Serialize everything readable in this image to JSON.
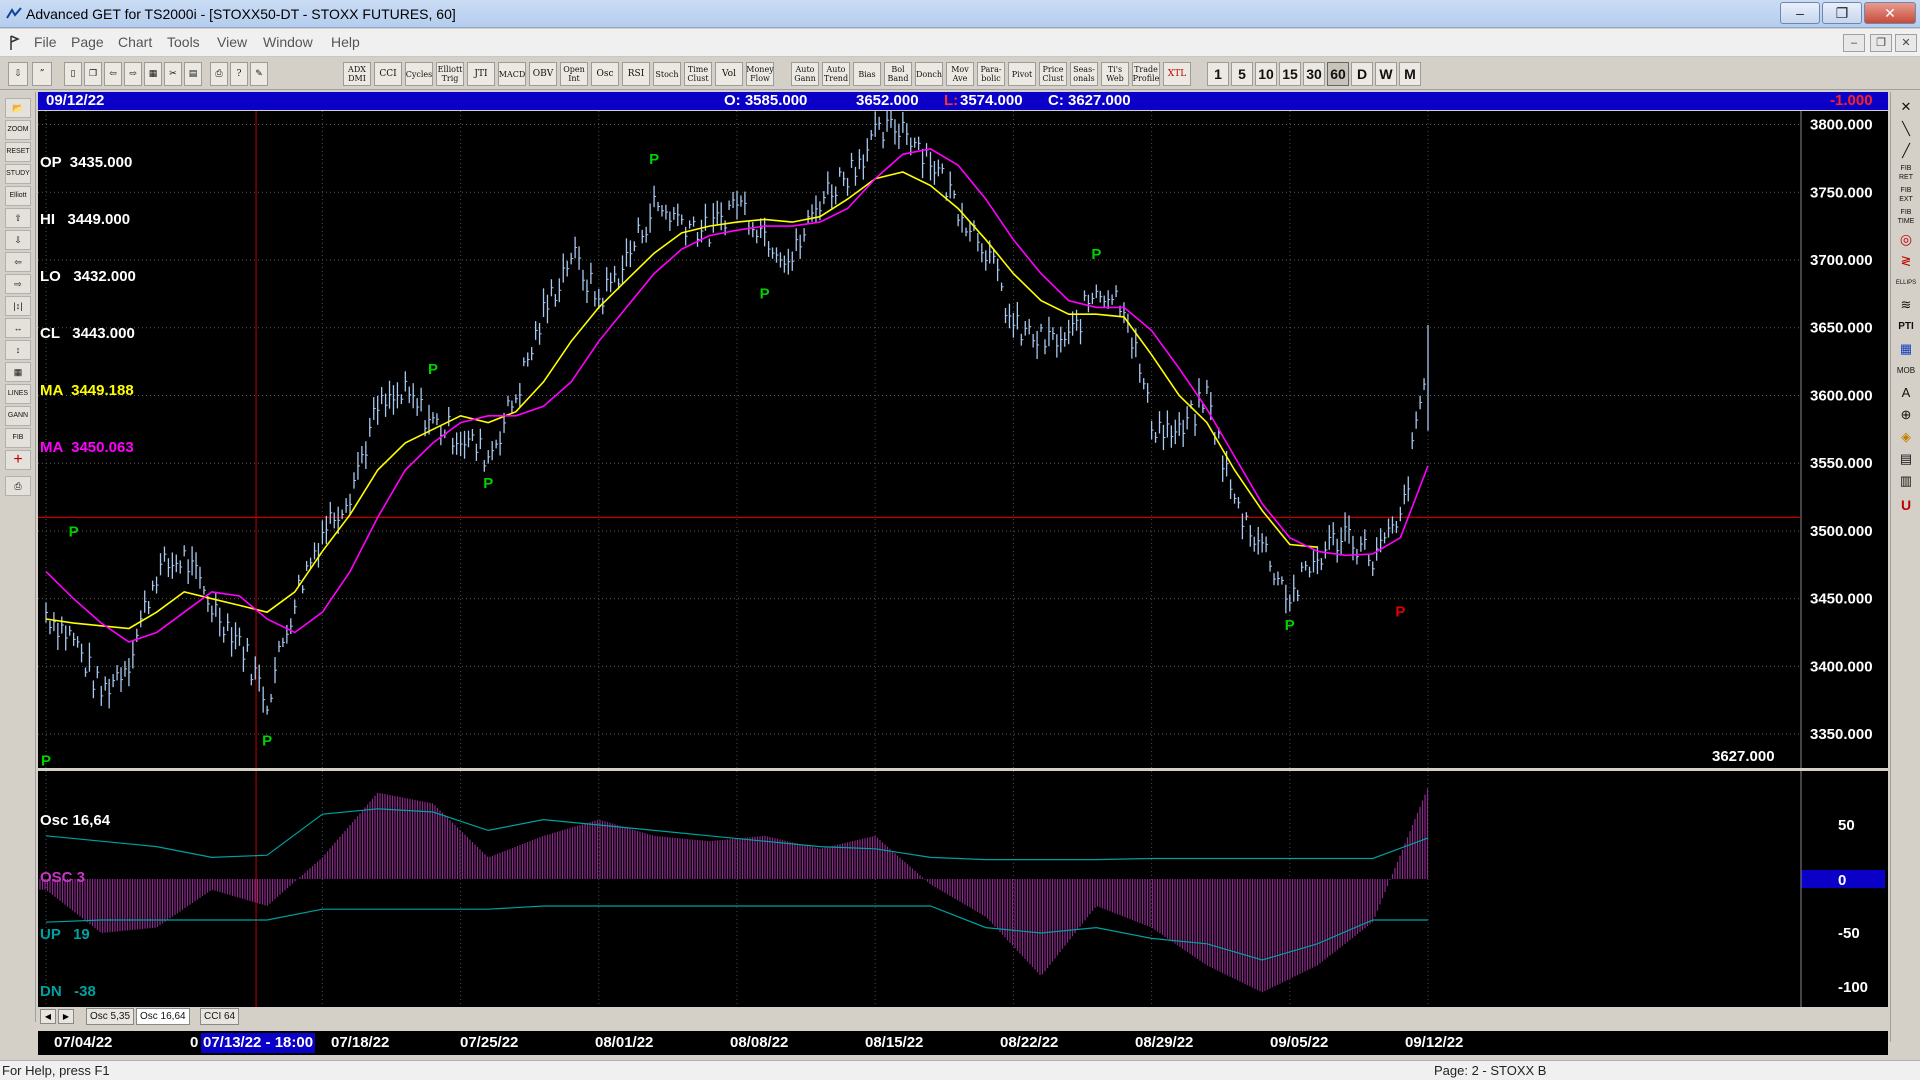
{
  "window": {
    "title": "Advanced GET for TS2000i - [STOXX50-DT - STOXX FUTURES, 60]",
    "buttons": [
      "–",
      "❐",
      "✕"
    ]
  },
  "menu": [
    "File",
    "Page",
    "Chart",
    "Tools",
    "View",
    "Window",
    "Help"
  ],
  "mdi_controls": [
    "–",
    "❐",
    "✕"
  ],
  "toolbar": {
    "indicators": [
      "ADX DMI",
      "CCI",
      "Cycles",
      "Elliott Trig",
      "JTI",
      "MACD",
      "OBV",
      "Open Int",
      "Osc",
      "RSI",
      "Stoch",
      "Time Clust",
      "Vol",
      "Money Flow",
      "Auto Gann",
      "Auto Trend",
      "Bias",
      "Bol Band",
      "Donch",
      "Mov Ave",
      "Para-bolic",
      "Pivot",
      "Price Clust",
      "Seas-onals",
      "Ti's Web",
      "Trade Profile",
      "XTL"
    ],
    "periods": [
      "1",
      "5",
      "10",
      "15",
      "30",
      "60",
      "D",
      "W",
      "M"
    ],
    "active_period": "60"
  },
  "left_tools": [
    "📂",
    "ZOOM",
    "RESET",
    "STUDY",
    "Elliott",
    "⇧",
    "⇩",
    "⇦",
    "⇨",
    "|↕|",
    "↔",
    "↕",
    "▦",
    "LINES",
    "GANN",
    "FIB",
    "+",
    "⎙"
  ],
  "right_tools": [
    "✕",
    "╲",
    "╱",
    "FIB RET",
    "FIB EXT",
    "FIB TIME",
    "◎",
    "≷",
    "ELLIPS",
    "≋",
    "PTI",
    "▦",
    "MOB",
    "A",
    "⊕",
    "◈",
    "▤",
    "▥",
    "U"
  ],
  "infobar": {
    "date": "09/12/22",
    "open": "O: 3585.000",
    "high": "3652.000",
    "low_label": "L:",
    "low": " 3574.000",
    "close": "C: 3627.000",
    "change": "-1.000"
  },
  "price_legend": [
    {
      "label": "OP  3435.000",
      "color": "#ffffff"
    },
    {
      "label": "HI   3449.000",
      "color": "#ffffff"
    },
    {
      "label": "LO   3432.000",
      "color": "#ffffff"
    },
    {
      "label": "CL   3443.000",
      "color": "#ffffff"
    },
    {
      "label": "MA  3449.188",
      "color": "#ffff00"
    },
    {
      "label": "MA  3450.063",
      "color": "#ff00ff"
    }
  ],
  "last_price_label": "3627.000",
  "osc_legend": [
    {
      "label": "Osc 16,64",
      "color": "#ffffff"
    },
    {
      "label": "OSC 3",
      "color": "#cc33cc"
    },
    {
      "label": "UP   19",
      "color": "#00a0a0"
    },
    {
      "label": "DN   -38",
      "color": "#00a0a0"
    }
  ],
  "osc_zero_label": "0",
  "tabs": [
    "Osc 5,35",
    "Osc 16,64",
    "CCI 64"
  ],
  "active_tab": "Osc 16,64",
  "date_labels": [
    "07/04/22",
    "0",
    "07/18/22",
    "07/25/22",
    "08/01/22",
    "08/08/22",
    "08/15/22",
    "08/22/22",
    "08/29/22",
    "09/05/22",
    "09/12/22"
  ],
  "cursor_label": "07/13/22 - 18:00",
  "status": {
    "left": "For Help, press F1",
    "right": "Page: 2 - STOXX B"
  },
  "colors": {
    "bars": "#a8c8f0",
    "ma_fast": "#ffff00",
    "ma_slow": "#ff00ff",
    "pivot_high": "#00d000",
    "pivot_red": "#e00000",
    "osc_hist": "#8a2a8a",
    "bands": "#00a0a0",
    "crosshair": "#c00000",
    "infobar": "#0a00c8"
  },
  "chart_data": [
    {
      "type": "line",
      "title": "STOXX50-DT - STOXX FUTURES, 60",
      "x": [
        "07/04",
        "07/05",
        "07/06",
        "07/07",
        "07/08",
        "07/11",
        "07/12",
        "07/13",
        "07/14",
        "07/15",
        "07/18",
        "07/19",
        "07/20",
        "07/21",
        "07/22",
        "07/25",
        "07/26",
        "07/27",
        "07/28",
        "07/29",
        "08/01",
        "08/02",
        "08/03",
        "08/04",
        "08/05",
        "08/08",
        "08/09",
        "08/10",
        "08/11",
        "08/12",
        "08/15",
        "08/16",
        "08/17",
        "08/18",
        "08/19",
        "08/22",
        "08/23",
        "08/24",
        "08/25",
        "08/26",
        "08/29",
        "08/30",
        "08/31",
        "09/01",
        "09/02",
        "09/05",
        "09/06",
        "09/07",
        "09/08",
        "09/09",
        "09/12"
      ],
      "series": [
        {
          "name": "",
          "values": [
            3440,
            3420,
            3380,
            3405,
            3470,
            3480,
            3445,
            3420,
            3375,
            3450,
            3500,
            3530,
            3590,
            3600,
            3580,
            3570,
            3555,
            3600,
            3660,
            3705,
            3670,
            3700,
            3740,
            3730,
            3720,
            3745,
            3720,
            3700,
            3745,
            3765,
            3790,
            3800,
            3775,
            3740,
            3710,
            3650,
            3640,
            3640,
            3680,
            3670,
            3580,
            3570,
            3600,
            3520,
            3490,
            3450,
            3480,
            3500,
            3480,
            3505,
            3627
          ]
        },
        {
          "name": "MA",
          "values": [
            3435,
            3432,
            3430,
            3428,
            3440,
            3455,
            3450,
            3445,
            3440,
            3455,
            3485,
            3512,
            3545,
            3565,
            3575,
            3585,
            3580,
            3588,
            3610,
            3640,
            3665,
            3685,
            3705,
            3720,
            3725,
            3728,
            3730,
            3728,
            3732,
            3745,
            3760,
            3765,
            3755,
            3738,
            3715,
            3690,
            3670,
            3660,
            3660,
            3658,
            3630,
            3600,
            3580,
            3545,
            3515,
            3490,
            3488,
            3492,
            3495,
            3505,
            3515
          ]
        },
        {
          "name": "MA",
          "values": [
            3470,
            3450,
            3432,
            3418,
            3425,
            3440,
            3455,
            3452,
            3435,
            3425,
            3440,
            3470,
            3510,
            3545,
            3565,
            3580,
            3585,
            3585,
            3592,
            3610,
            3640,
            3665,
            3690,
            3708,
            3718,
            3722,
            3725,
            3725,
            3728,
            3738,
            3760,
            3778,
            3782,
            3770,
            3745,
            3715,
            3690,
            3670,
            3665,
            3665,
            3648,
            3620,
            3590,
            3555,
            3520,
            3495,
            3485,
            3482,
            3483,
            3495,
            3548
          ]
        }
      ],
      "ylim": [
        3325,
        3810
      ],
      "ytick_labels": [
        "3350.000",
        "3400.000",
        "3450.000",
        "3500.000",
        "3550.000",
        "3600.000",
        "3650.000",
        "3700.000",
        "3750.000",
        "3800.000"
      ],
      "pivots": [
        {
          "x": "07/05",
          "label": "P",
          "kind": "high",
          "price": 3490
        },
        {
          "x": "07/04",
          "label": "P",
          "kind": "low",
          "price": 3340
        },
        {
          "x": "07/14",
          "label": "P",
          "kind": "low",
          "price": 3355
        },
        {
          "x": "07/22",
          "label": "P",
          "kind": "high",
          "price": 3610
        },
        {
          "x": "07/26",
          "label": "P",
          "kind": "low",
          "price": 3545
        },
        {
          "x": "08/03",
          "label": "P",
          "kind": "high",
          "price": 3765
        },
        {
          "x": "08/09",
          "label": "P",
          "kind": "low",
          "price": 3685
        },
        {
          "x": "08/25",
          "label": "P",
          "kind": "high",
          "price": 3695
        },
        {
          "x": "09/05",
          "label": "P",
          "kind": "low",
          "price": 3440
        },
        {
          "x": "09/09",
          "label": "P",
          "kind": "red",
          "price": 3450
        }
      ],
      "horizontal_line": 3510,
      "vertical_cursor": "07/13/22 - 18:00"
    },
    {
      "type": "bar",
      "title": "Osc 16,64",
      "x": [
        "07/04",
        "07/06",
        "07/08",
        "07/12",
        "07/14",
        "07/18",
        "07/20",
        "07/22",
        "07/26",
        "07/28",
        "08/01",
        "08/03",
        "08/05",
        "08/09",
        "08/11",
        "08/15",
        "08/17",
        "08/19",
        "08/23",
        "08/25",
        "08/29",
        "08/31",
        "09/02",
        "09/06",
        "09/08",
        "09/12"
      ],
      "series": [
        {
          "name": "OSC",
          "values": [
            -10,
            -50,
            -45,
            -10,
            -25,
            20,
            80,
            70,
            20,
            40,
            55,
            40,
            35,
            40,
            28,
            40,
            -5,
            -35,
            -90,
            -25,
            -45,
            -80,
            -105,
            -80,
            -40,
            85
          ]
        },
        {
          "name": "UP",
          "values": [
            40,
            35,
            30,
            20,
            22,
            60,
            65,
            62,
            45,
            55,
            50,
            45,
            40,
            35,
            30,
            28,
            20,
            18,
            18,
            18,
            19,
            19,
            19,
            19,
            19,
            38
          ]
        },
        {
          "name": "DN",
          "values": [
            -40,
            -38,
            -38,
            -38,
            -38,
            -28,
            -28,
            -28,
            -28,
            -25,
            -25,
            -25,
            -25,
            -25,
            -25,
            -25,
            -25,
            -45,
            -50,
            -45,
            -55,
            -60,
            -75,
            -60,
            -38,
            -38
          ]
        }
      ],
      "ylim": [
        -115,
        90
      ],
      "ytick_labels": [
        "50",
        "0",
        "-50",
        "-100"
      ]
    }
  ]
}
